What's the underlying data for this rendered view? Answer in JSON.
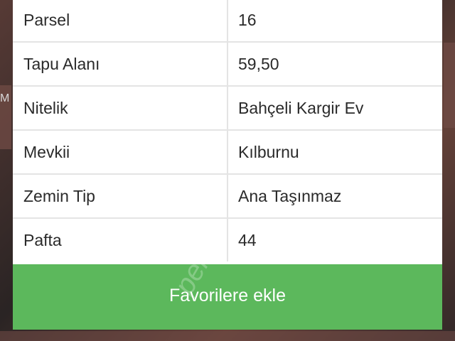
{
  "table": {
    "rows": [
      {
        "key": "Parsel",
        "value": "16"
      },
      {
        "key": "Tapu Alanı",
        "value": "59,50"
      },
      {
        "key": "Nitelik",
        "value": "Bahçeli Kargir Ev"
      },
      {
        "key": "Mevkii",
        "value": "Kılburnu"
      },
      {
        "key": "Zemin Tip",
        "value": "Ana Taşınmaz"
      },
      {
        "key": "Pafta",
        "value": "44"
      }
    ]
  },
  "actions": {
    "favorite_label": "Favorilere ekle"
  },
  "watermark": "pen",
  "colors": {
    "button_green": "#5cb85c",
    "row_divider": "#e4e4e4",
    "text": "#2a2a2a"
  }
}
